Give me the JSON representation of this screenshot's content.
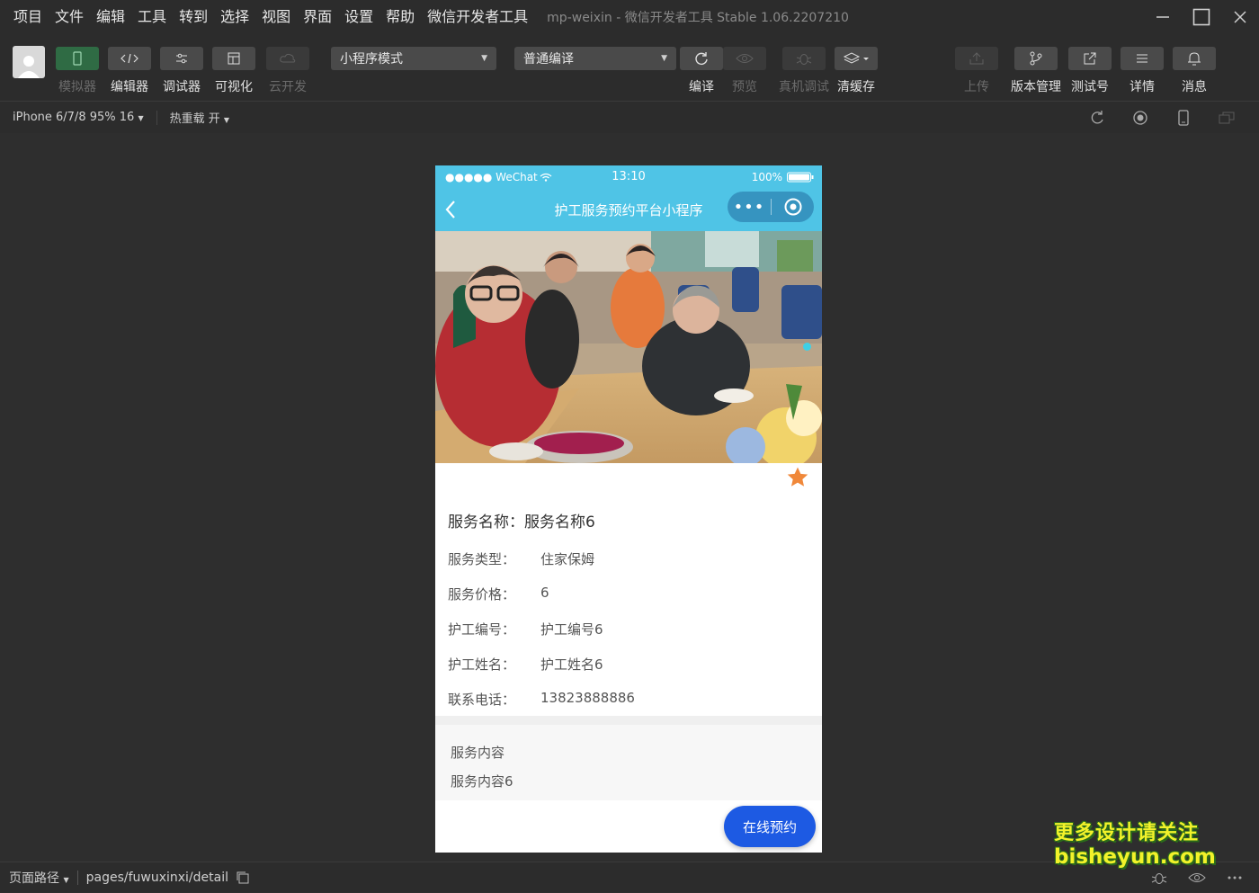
{
  "menu": [
    "项目",
    "文件",
    "编辑",
    "工具",
    "转到",
    "选择",
    "视图",
    "界面",
    "设置",
    "帮助",
    "微信开发者工具"
  ],
  "window_title": "mp-weixin - 微信开发者工具 Stable 1.06.2207210",
  "toolbar": {
    "simulator": "模拟器",
    "editor": "编辑器",
    "debugger": "调试器",
    "visualize": "可视化",
    "cloud": "云开发",
    "mode_select": "小程序模式",
    "compile_select": "普通编译",
    "compile": "编译",
    "preview": "预览",
    "remote_debug": "真机调试",
    "clear_cache": "清缓存",
    "upload": "上传",
    "version_mgmt": "版本管理",
    "test_account": "测试号",
    "details": "详情",
    "messages": "消息"
  },
  "subbar": {
    "device": "iPhone 6/7/8 95% 16",
    "hot_reload": "热重载 开"
  },
  "phone": {
    "carrier": "●●●●● WeChat",
    "time": "13:10",
    "battery": "100%",
    "nav_title": "护工服务预约平台小程序",
    "capsule_dots": "•••",
    "service_name_label": "服务名称：",
    "service_name_value": "服务名称6",
    "fields": [
      {
        "k": "服务类型：",
        "v": "住家保姆"
      },
      {
        "k": "服务价格：",
        "v": "6"
      },
      {
        "k": "护工编号：",
        "v": "护工编号6"
      },
      {
        "k": "护工姓名：",
        "v": "护工姓名6"
      },
      {
        "k": "联系电话：",
        "v": "13823888886"
      }
    ],
    "content_title": "服务内容",
    "content_text": "服务内容6",
    "book_button": "在线预约"
  },
  "bottombar": {
    "path_label": "页面路径",
    "path_value": "pages/fuwuxinxi/detail"
  },
  "watermark": {
    "line1": "更多设计请关注",
    "line2": "bisheyun.com"
  },
  "colors": {
    "nav_bg": "#4fc4e6",
    "book_button": "#1d5ae3",
    "star": "#f0883a"
  }
}
